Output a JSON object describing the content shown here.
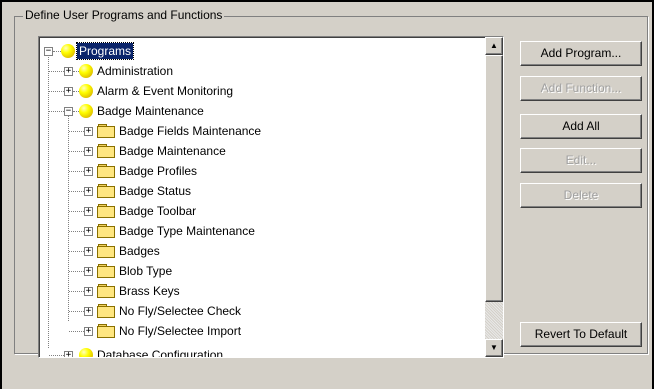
{
  "group": {
    "title": "Define User Programs and Functions"
  },
  "tree": {
    "root": {
      "label": "Programs"
    },
    "nodes": [
      {
        "label": "Administration"
      },
      {
        "label": "Alarm & Event Monitoring"
      },
      {
        "label": "Badge Maintenance"
      },
      {
        "label": "Badge Fields Maintenance"
      },
      {
        "label": "Badge Maintenance"
      },
      {
        "label": "Badge Profiles"
      },
      {
        "label": "Badge Status"
      },
      {
        "label": "Badge Toolbar"
      },
      {
        "label": "Badge Type Maintenance"
      },
      {
        "label": "Badges"
      },
      {
        "label": "Blob Type"
      },
      {
        "label": "Brass Keys"
      },
      {
        "label": "No Fly/Selectee Check"
      },
      {
        "label": "No Fly/Selectee Import"
      }
    ],
    "partial": {
      "label": "Database Configuration"
    },
    "scroll_up": "▲",
    "scroll_down": "▼"
  },
  "buttons": {
    "add_program": "Add Program...",
    "add_function": "Add Function...",
    "add_all": "Add All",
    "edit": "Edit...",
    "delete": "Delete",
    "revert": "Revert To Default"
  }
}
